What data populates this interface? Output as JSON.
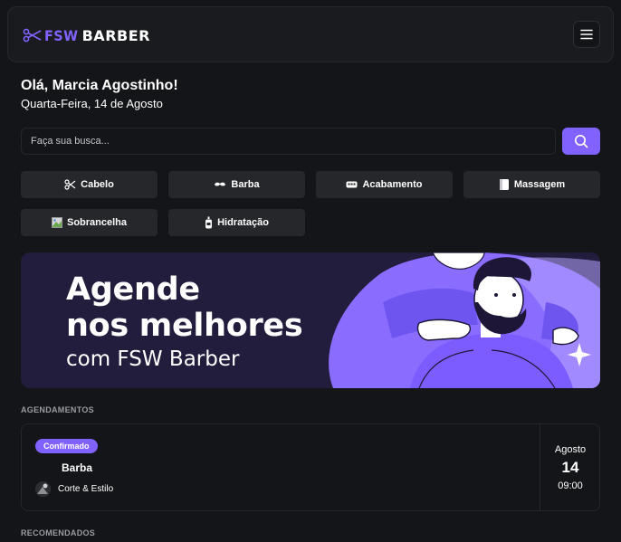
{
  "header": {
    "logo_text_fsw": "FSW",
    "logo_text_barber": "BARBER",
    "menu_icon": "hamburger-menu-icon"
  },
  "welcome": {
    "greeting": "Olá, Marcia Agostinho!",
    "date": "Quarta-Feira, 14 de Agosto"
  },
  "search": {
    "placeholder": "Faça sua busca...",
    "value": "",
    "icon": "search-icon"
  },
  "categories": [
    {
      "label": "Cabelo",
      "icon": "scissors-icon"
    },
    {
      "label": "Barba",
      "icon": "mustache-icon"
    },
    {
      "label": "Acabamento",
      "icon": "razor-icon"
    },
    {
      "label": "Massagem",
      "icon": "towel-icon"
    },
    {
      "label": "Sobrancelha",
      "icon": "broken-image-icon"
    },
    {
      "label": "Hidratação",
      "icon": "bottle-icon"
    }
  ],
  "banner": {
    "line1": "Agende",
    "line2": "nos melhores",
    "line3": "com FSW Barber"
  },
  "bookings_section": {
    "title": "AGENDAMENTOS"
  },
  "booking": {
    "status": "Confirmado",
    "service": "Barba",
    "barbershop": "Corte & Estilo",
    "month": "Agosto",
    "day": "14",
    "time": "09:00"
  },
  "recommended_section": {
    "title": "RECOMENDADOS"
  },
  "colors": {
    "background": "#141518",
    "card": "#26272b",
    "accent": "#8162ff",
    "banner_bg": "#221c3d"
  }
}
